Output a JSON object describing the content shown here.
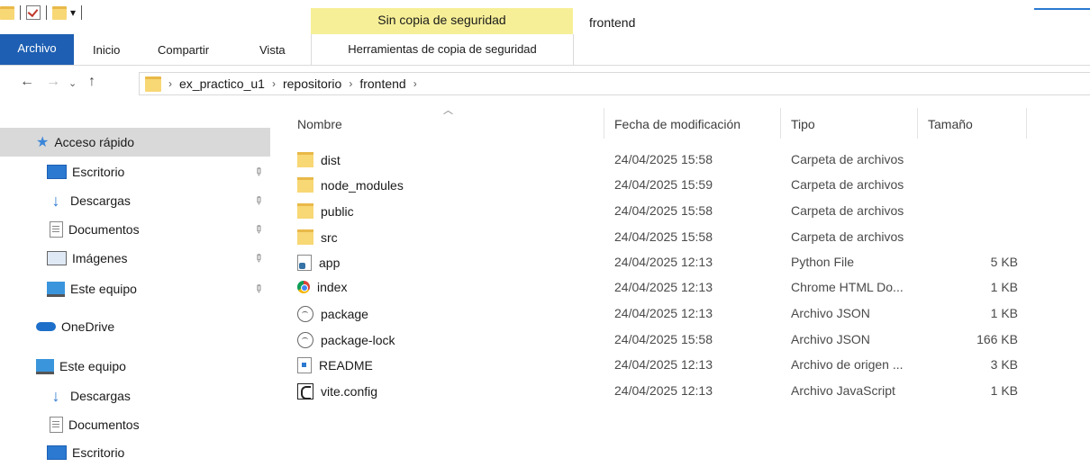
{
  "window": {
    "title": "frontend",
    "context_tab_group": "Sin copia de seguridad"
  },
  "ribbon": {
    "tabs": [
      "Archivo",
      "Inicio",
      "Compartir",
      "Vista",
      "Herramientas de copia de seguridad"
    ]
  },
  "address": {
    "crumbs": [
      "ex_practico_u1",
      "repositorio",
      "frontend"
    ]
  },
  "sidebar": {
    "items": [
      {
        "label": "Acceso rápido",
        "icon": "star-icon"
      },
      {
        "label": "Escritorio",
        "icon": "desktop-icon"
      },
      {
        "label": "Descargas",
        "icon": "download-icon"
      },
      {
        "label": "Documentos",
        "icon": "documents-icon"
      },
      {
        "label": "Imágenes",
        "icon": "pictures-icon"
      },
      {
        "label": "Este equipo",
        "icon": "computer-icon"
      },
      {
        "label": "OneDrive",
        "icon": "cloud-icon"
      },
      {
        "label": "Este equipo",
        "icon": "computer-icon"
      },
      {
        "label": "Descargas",
        "icon": "download-icon"
      },
      {
        "label": "Documentos",
        "icon": "documents-icon"
      },
      {
        "label": "Escritorio",
        "icon": "desktop-icon"
      }
    ]
  },
  "list": {
    "columns": {
      "name": "Nombre",
      "date": "Fecha de modificación",
      "type": "Tipo",
      "size": "Tamaño"
    },
    "rows": [
      {
        "name": "dist",
        "date": "24/04/2025 15:58",
        "type": "Carpeta de archivos",
        "size": "",
        "icon": "folder-icon"
      },
      {
        "name": "node_modules",
        "date": "24/04/2025 15:59",
        "type": "Carpeta de archivos",
        "size": "",
        "icon": "folder-icon"
      },
      {
        "name": "public",
        "date": "24/04/2025 15:58",
        "type": "Carpeta de archivos",
        "size": "",
        "icon": "folder-icon"
      },
      {
        "name": "src",
        "date": "24/04/2025 15:58",
        "type": "Carpeta de archivos",
        "size": "",
        "icon": "folder-icon"
      },
      {
        "name": "app",
        "date": "24/04/2025 12:13",
        "type": "Python File",
        "size": "5 KB",
        "icon": "python-file-icon"
      },
      {
        "name": "index",
        "date": "24/04/2025 12:13",
        "type": "Chrome HTML Do...",
        "size": "1 KB",
        "icon": "chrome-html-icon"
      },
      {
        "name": "package",
        "date": "24/04/2025 12:13",
        "type": "Archivo JSON",
        "size": "1 KB",
        "icon": "json-file-icon"
      },
      {
        "name": "package-lock",
        "date": "24/04/2025 15:58",
        "type": "Archivo JSON",
        "size": "166 KB",
        "icon": "json-file-icon"
      },
      {
        "name": "README",
        "date": "24/04/2025 12:13",
        "type": "Archivo de origen ...",
        "size": "3 KB",
        "icon": "markdown-file-icon"
      },
      {
        "name": "vite.config",
        "date": "24/04/2025 12:13",
        "type": "Archivo JavaScript",
        "size": "1 KB",
        "icon": "javascript-file-icon"
      }
    ]
  },
  "colors": {
    "file_tab": "#1e5fb3",
    "context_tab": "#f6ef97",
    "selection": "#d9d9d9"
  }
}
